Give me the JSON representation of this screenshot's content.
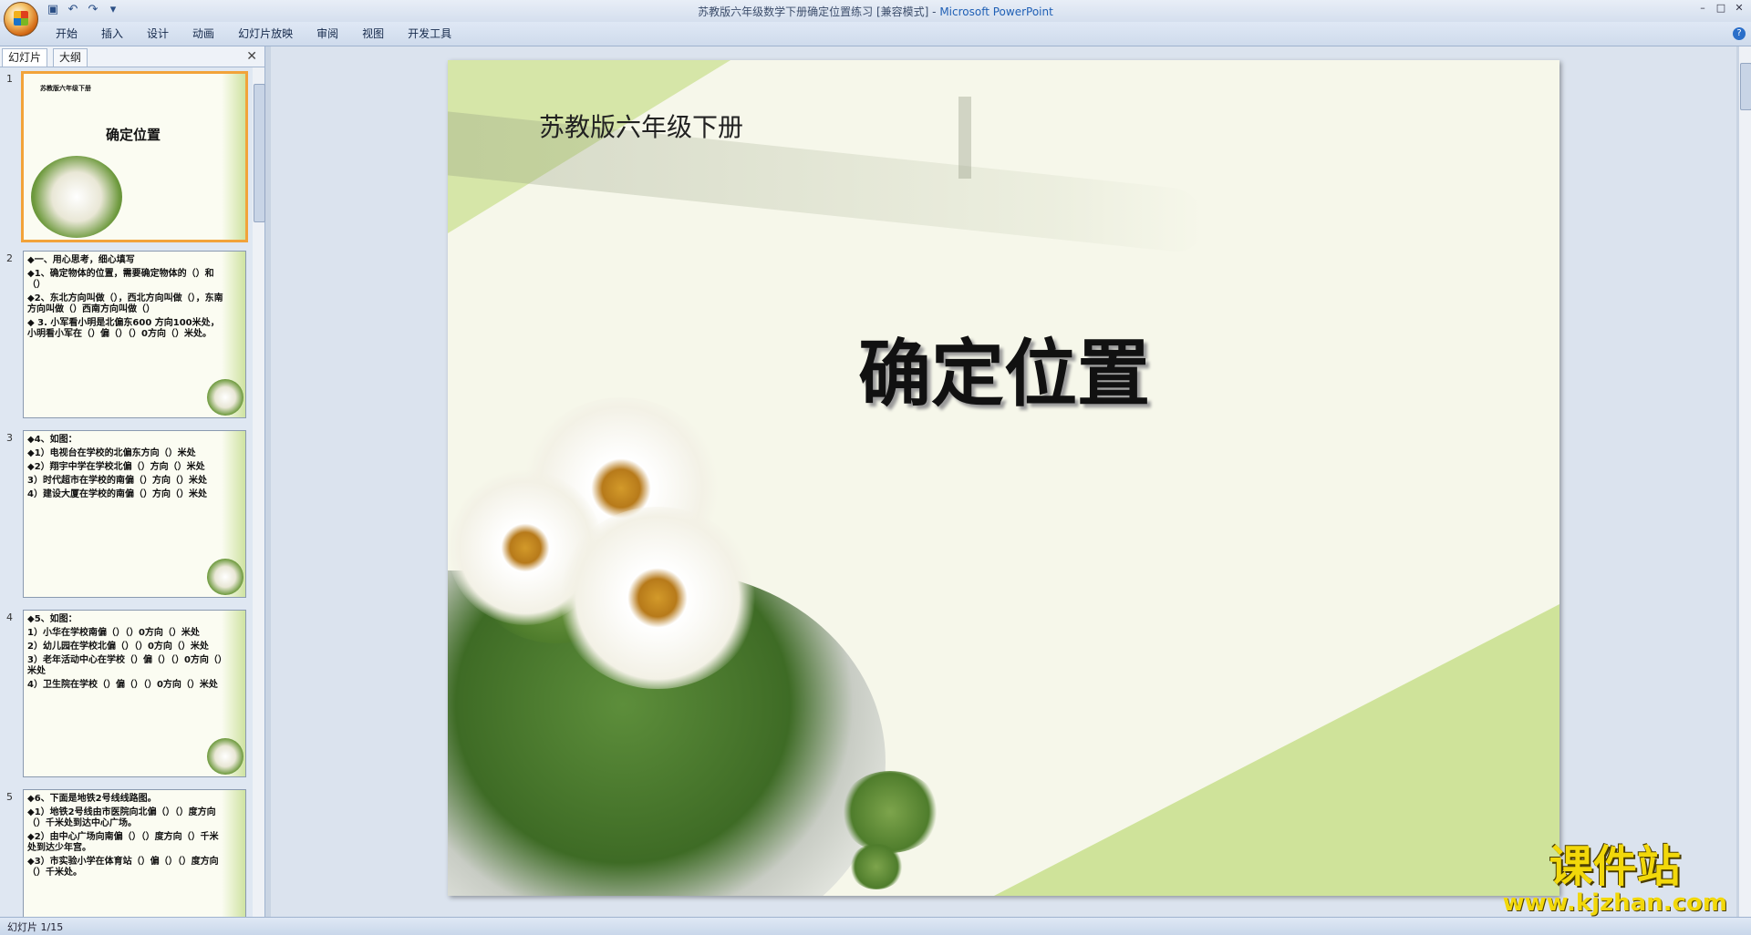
{
  "window": {
    "title": "苏教版六年级数学下册确定位置练习 [兼容模式] - ",
    "app_name": "Microsoft PowerPoint"
  },
  "ribbon": {
    "tabs": [
      "开始",
      "插入",
      "设计",
      "动画",
      "幻灯片放映",
      "审阅",
      "视图",
      "开发工具"
    ]
  },
  "panel": {
    "tab_slides": "幻灯片",
    "tab_outline": "大纲"
  },
  "thumbnails": [
    {
      "num": "1",
      "lines": [
        "苏教版六年级下册",
        "确定位置"
      ]
    },
    {
      "num": "2",
      "lines": [
        "◆一、用心思考，细心填写",
        "◆1、确定物体的位置，需要确定物体的（）和（）",
        "◆2、东北方向叫做（），西北方向叫做（），东南方向叫做（）西南方向叫做（）",
        "◆ 3. 小军看小明是北偏东600 方向100米处，小明看小军在（）偏（）（）0方向（）米处。"
      ]
    },
    {
      "num": "3",
      "lines": [
        "◆4、如图：",
        "◆1）电视台在学校的北偏东方向（）米处",
        "◆2）翔宇中学在学校北偏（）方向（）米处",
        "3）时代超市在学校的南偏（）方向（）米处",
        "4）建设大厦在学校的南偏（）方向（）米处"
      ]
    },
    {
      "num": "4",
      "lines": [
        "◆5、如图：",
        "1）小华在学校南偏（）（）0方向（）米处",
        "2）幼儿园在学校北偏（）（）0方向（）米处",
        "3）老年活动中心在学校（）偏（）（）0方向（）米处",
        "4）卫生院在学校（）偏（）（）0方向（）米处"
      ]
    },
    {
      "num": "5",
      "lines": [
        "◆6、下面是地铁2号线线路图。",
        "◆1）地铁2号线由市医院向北偏（）（）度方向（）千米处到达中心广场。",
        "◆2）由中心广场向南偏（）（）度方向（）千米处到达少年宫。",
        "◆3）市实验小学在体育站（）偏（）（）度方向（）千米处。"
      ]
    }
  ],
  "slide": {
    "subtitle": "苏教版六年级下册",
    "title": "确定位置"
  },
  "status": {
    "text": "幻灯片 1/15"
  },
  "watermark": {
    "name": "课件站",
    "url": "www.kjzhan.com"
  },
  "colors": {
    "selected_thumb_border": "#f2a33a",
    "slide_bg": "#f6f7ea",
    "slide_accent": "#cfe39a"
  }
}
